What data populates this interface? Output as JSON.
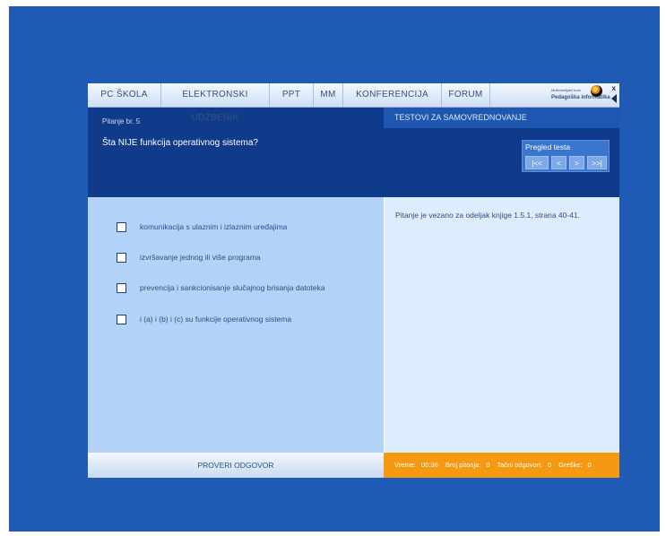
{
  "nav": {
    "items": [
      "PC ŠKOLA",
      "ELEKTRONSKI UDŽBENIK",
      "PPT",
      "MM",
      "KONFERENCIJA",
      "FORUM"
    ],
    "logo_small": "Multimedijalni kurs",
    "logo_big": "Pedagoška informatika",
    "close_label": "x"
  },
  "question": {
    "label": "Pitanje br. 5",
    "text": "Šta NIJE funkcija operativnog sistema?"
  },
  "tests": {
    "heading": "TESTOVI ZA SAMOVREDNOVANJE"
  },
  "review": {
    "title": "Pregled testa",
    "buttons": [
      "|<<",
      "<",
      ">",
      ">>|"
    ]
  },
  "options": [
    "komunikacija s ulaznim i izlaznim uređajima",
    "izvršavanje jednog ili više programa",
    "prevencija i sankcionisanje slučajnog brisanja datoteka",
    "i (a) i (b) i (c) su funkcije operativnog sistema"
  ],
  "info": {
    "text": "Pitanje je vezano za odeljak knjige 1.5.1, strana 40-41."
  },
  "footer": {
    "check_label": "PROVERI ODGOVOR",
    "time_label": "Vreme:",
    "time_value": "00:36",
    "count_label": "Broj pitanja:",
    "count_value": "0",
    "correct_label": "Tačni odgovori:",
    "correct_value": "0",
    "errors_label": "Greške:",
    "errors_value": "0"
  },
  "colors": {
    "background": "#1f5bb5",
    "panel_dark": "#103a8a",
    "answers_bg": "#b3d2f7",
    "info_bg": "#deedfd",
    "status_bg": "#f59a10"
  }
}
